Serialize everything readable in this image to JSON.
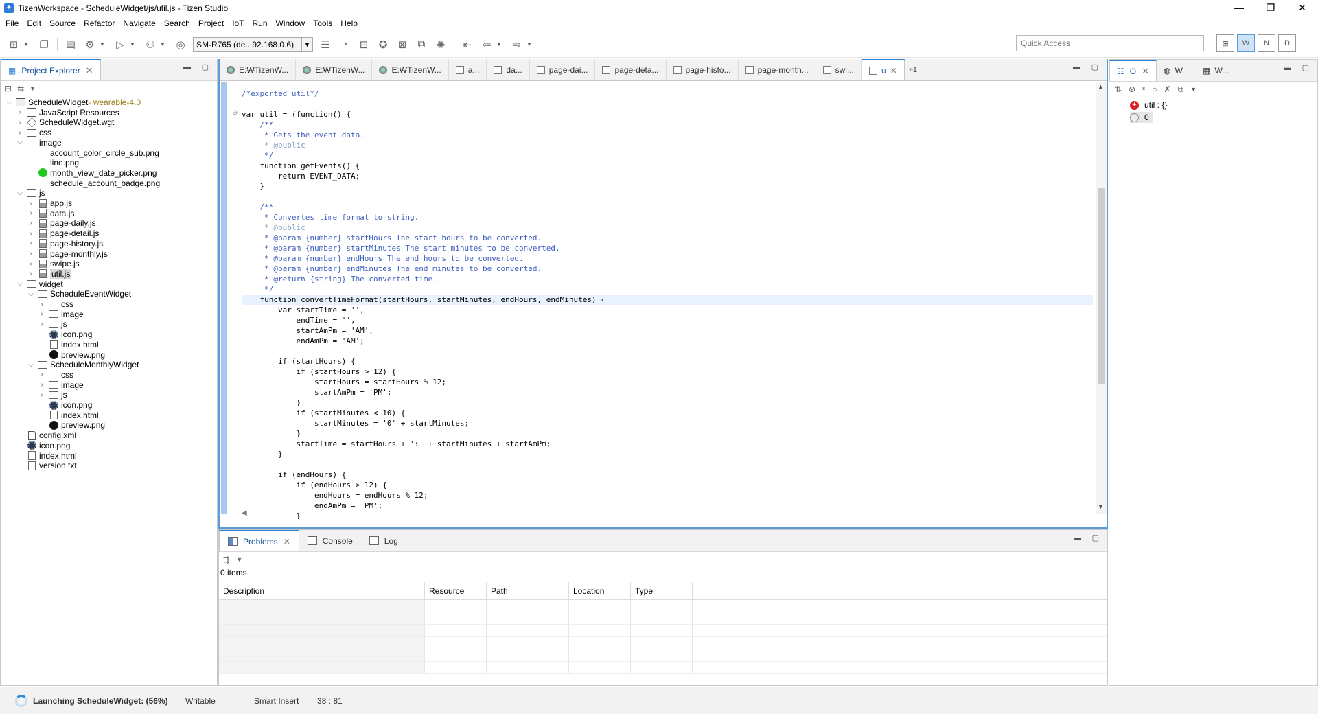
{
  "window": {
    "title": "TizenWorkspace - ScheduleWidget/js/util.js - Tizen Studio",
    "minimize": "—",
    "restore": "❐",
    "close": "✕"
  },
  "menu": [
    "File",
    "Edit",
    "Source",
    "Refactor",
    "Navigate",
    "Search",
    "Project",
    "IoT",
    "Run",
    "Window",
    "Tools",
    "Help"
  ],
  "toolbar": {
    "device": "SM-R765 (de...92.168.0.6)",
    "quick_access_placeholder": "Quick Access",
    "perspectives": [
      "W",
      "N",
      "D"
    ]
  },
  "project_explorer": {
    "tab_label": "Project Explorer",
    "tree": [
      {
        "label": "ScheduleWidget",
        "suffix": " - wearable-4.0",
        "depth": 0,
        "twisty": "open",
        "icon": "project"
      },
      {
        "label": "JavaScript Resources",
        "depth": 1,
        "twisty": "closed",
        "icon": "resources"
      },
      {
        "label": "ScheduleWidget.wgt",
        "depth": 1,
        "twisty": "closed",
        "icon": "wgt"
      },
      {
        "label": "css",
        "depth": 1,
        "twisty": "closed",
        "icon": "folder"
      },
      {
        "label": "image",
        "depth": 1,
        "twisty": "open",
        "icon": "folder"
      },
      {
        "label": "account_color_circle_sub.png",
        "depth": 2,
        "twisty": "none",
        "icon": "none"
      },
      {
        "label": "line.png",
        "depth": 2,
        "twisty": "none",
        "icon": "none"
      },
      {
        "label": "month_view_date_picker.png",
        "depth": 2,
        "twisty": "none",
        "icon": "green"
      },
      {
        "label": "schedule_account_badge.png",
        "depth": 2,
        "twisty": "none",
        "icon": "none"
      },
      {
        "label": "js",
        "depth": 1,
        "twisty": "open",
        "icon": "folder"
      },
      {
        "label": "app.js",
        "depth": 2,
        "twisty": "closed",
        "icon": "js"
      },
      {
        "label": "data.js",
        "depth": 2,
        "twisty": "closed",
        "icon": "js"
      },
      {
        "label": "page-daily.js",
        "depth": 2,
        "twisty": "closed",
        "icon": "js"
      },
      {
        "label": "page-detail.js",
        "depth": 2,
        "twisty": "closed",
        "icon": "js"
      },
      {
        "label": "page-history.js",
        "depth": 2,
        "twisty": "closed",
        "icon": "js"
      },
      {
        "label": "page-monthly.js",
        "depth": 2,
        "twisty": "closed",
        "icon": "js"
      },
      {
        "label": "swipe.js",
        "depth": 2,
        "twisty": "closed",
        "icon": "js"
      },
      {
        "label": "util.js",
        "depth": 2,
        "twisty": "closed",
        "icon": "js",
        "selected": true
      },
      {
        "label": "widget",
        "depth": 1,
        "twisty": "open",
        "icon": "folder"
      },
      {
        "label": "ScheduleEventWidget",
        "depth": 2,
        "twisty": "open",
        "icon": "folder"
      },
      {
        "label": "css",
        "depth": 3,
        "twisty": "closed",
        "icon": "folder"
      },
      {
        "label": "image",
        "depth": 3,
        "twisty": "closed",
        "icon": "folder"
      },
      {
        "label": "js",
        "depth": 3,
        "twisty": "closed",
        "icon": "folder"
      },
      {
        "label": "icon.png",
        "depth": 3,
        "twisty": "none",
        "icon": "gear"
      },
      {
        "label": "index.html",
        "depth": 3,
        "twisty": "none",
        "icon": "file"
      },
      {
        "label": "preview.png",
        "depth": 3,
        "twisty": "none",
        "icon": "black"
      },
      {
        "label": "ScheduleMonthlyWidget",
        "depth": 2,
        "twisty": "open",
        "icon": "folder"
      },
      {
        "label": "css",
        "depth": 3,
        "twisty": "closed",
        "icon": "folder"
      },
      {
        "label": "image",
        "depth": 3,
        "twisty": "closed",
        "icon": "folder"
      },
      {
        "label": "js",
        "depth": 3,
        "twisty": "closed",
        "icon": "folder"
      },
      {
        "label": "icon.png",
        "depth": 3,
        "twisty": "none",
        "icon": "gear"
      },
      {
        "label": "index.html",
        "depth": 3,
        "twisty": "none",
        "icon": "file"
      },
      {
        "label": "preview.png",
        "depth": 3,
        "twisty": "none",
        "icon": "black"
      },
      {
        "label": "config.xml",
        "depth": 1,
        "twisty": "none",
        "icon": "xml"
      },
      {
        "label": "icon.png",
        "depth": 1,
        "twisty": "none",
        "icon": "gear"
      },
      {
        "label": "index.html",
        "depth": 1,
        "twisty": "none",
        "icon": "file"
      },
      {
        "label": "version.txt",
        "depth": 1,
        "twisty": "none",
        "icon": "file"
      }
    ]
  },
  "editor_tabs": [
    {
      "label": "E:₩TizenW...",
      "icon": "globe"
    },
    {
      "label": "E:₩TizenW...",
      "icon": "globe"
    },
    {
      "label": "E:₩TizenW...",
      "icon": "globe"
    },
    {
      "label": "a...",
      "icon": "js"
    },
    {
      "label": "da...",
      "icon": "js"
    },
    {
      "label": "page-dai...",
      "icon": "js"
    },
    {
      "label": "page-deta...",
      "icon": "js"
    },
    {
      "label": "page-histo...",
      "icon": "js"
    },
    {
      "label": "page-month...",
      "icon": "js"
    },
    {
      "label": "swi...",
      "icon": "js"
    },
    {
      "label": "u",
      "icon": "js",
      "active": true
    }
  ],
  "editor_overflow": "»1",
  "code_lines": [
    {
      "t": "/*exported util*/",
      "c": "cm"
    },
    {
      "t": ""
    },
    {
      "t": "var util = (function() {",
      "fold": true
    },
    {
      "t": "    /**",
      "c": "cm"
    },
    {
      "t": "     * Gets the event data.",
      "c": "cm"
    },
    {
      "t": "     * @public",
      "c": "tag"
    },
    {
      "t": "     */",
      "c": "cm"
    },
    {
      "t": "    function getEvents() {"
    },
    {
      "t": "        return EVENT_DATA;"
    },
    {
      "t": "    }"
    },
    {
      "t": ""
    },
    {
      "t": "    /**",
      "c": "cm"
    },
    {
      "t": "     * Convertes time format to string.",
      "c": "cm"
    },
    {
      "t": "     * @public",
      "c": "tag"
    },
    {
      "t": "     * @param {number} startHours The start hours to be converted.",
      "c": "cm"
    },
    {
      "t": "     * @param {number} startMinutes The start minutes to be converted.",
      "c": "cm"
    },
    {
      "t": "     * @param {number} endHours The end hours to be converted.",
      "c": "cm"
    },
    {
      "t": "     * @param {number} endMinutes The end minutes to be converted.",
      "c": "cm"
    },
    {
      "t": "     * @return {string} The converted time.",
      "c": "cm"
    },
    {
      "t": "     */",
      "c": "cm"
    },
    {
      "t": "    function convertTimeFormat(startHours, startMinutes, endHours, endMinutes) {",
      "hl": true
    },
    {
      "t": "        var startTime = '',"
    },
    {
      "t": "            endTime = '',"
    },
    {
      "t": "            startAmPm = 'AM',"
    },
    {
      "t": "            endAmPm = 'AM';"
    },
    {
      "t": ""
    },
    {
      "t": "        if (startHours) {"
    },
    {
      "t": "            if (startHours > 12) {"
    },
    {
      "t": "                startHours = startHours % 12;"
    },
    {
      "t": "                startAmPm = 'PM';"
    },
    {
      "t": "            }"
    },
    {
      "t": "            if (startMinutes < 10) {"
    },
    {
      "t": "                startMinutes = '0' + startMinutes;"
    },
    {
      "t": "            }"
    },
    {
      "t": "            startTime = startHours + ':' + startMinutes + startAmPm;"
    },
    {
      "t": "        }"
    },
    {
      "t": ""
    },
    {
      "t": "        if (endHours) {"
    },
    {
      "t": "            if (endHours > 12) {"
    },
    {
      "t": "                endHours = endHours % 12;"
    },
    {
      "t": "                endAmPm = 'PM';"
    },
    {
      "t": "            }"
    }
  ],
  "bottom_panel": {
    "tabs": [
      {
        "label": "Problems",
        "active": true
      },
      {
        "label": "Console"
      },
      {
        "label": "Log"
      }
    ],
    "items_count": "0 items",
    "columns": [
      "Description",
      "Resource",
      "Path",
      "Location",
      "Type"
    ]
  },
  "right_panel": {
    "tabs": [
      "O",
      "W...",
      "W..."
    ],
    "outline": [
      {
        "label": "util : {}",
        "icon": "redplus"
      },
      {
        "label": "0",
        "icon": "circle"
      }
    ]
  },
  "status": {
    "launching": "Launching ScheduleWidget: (56%)",
    "writable": "Writable",
    "insert_mode": "Smart Insert",
    "position": "38 : 81"
  }
}
